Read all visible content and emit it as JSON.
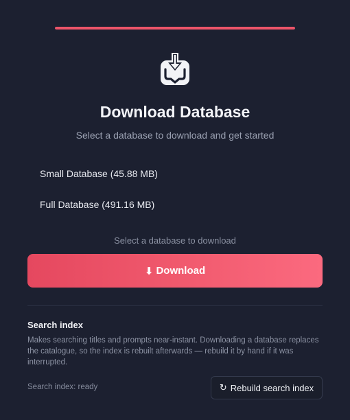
{
  "progress": {
    "fraction": 1.0,
    "color": "#ec5469"
  },
  "header": {
    "icon": "download-box-icon",
    "title": "Download Database",
    "subtitle": "Select a database to download and get started"
  },
  "options": [
    {
      "label": "Small Database (45.88 MB)"
    },
    {
      "label": "Full Database (491.16 MB)"
    }
  ],
  "hint": "Select a database to download",
  "download_button": {
    "icon_glyph": "⬇",
    "label": "Download"
  },
  "search_index": {
    "title": "Search index",
    "description": "Makes searching titles and prompts near-instant. Downloading a database replaces the catalogue, so the index is rebuilt afterwards — rebuild it by hand if it was interrupted.",
    "status": "Search index: ready",
    "rebuild_icon_glyph": "↻",
    "rebuild_label": "Rebuild search index"
  },
  "colors": {
    "background": "#1c2030",
    "accent": "#ec5469",
    "accent_light": "#fb6a7f"
  }
}
